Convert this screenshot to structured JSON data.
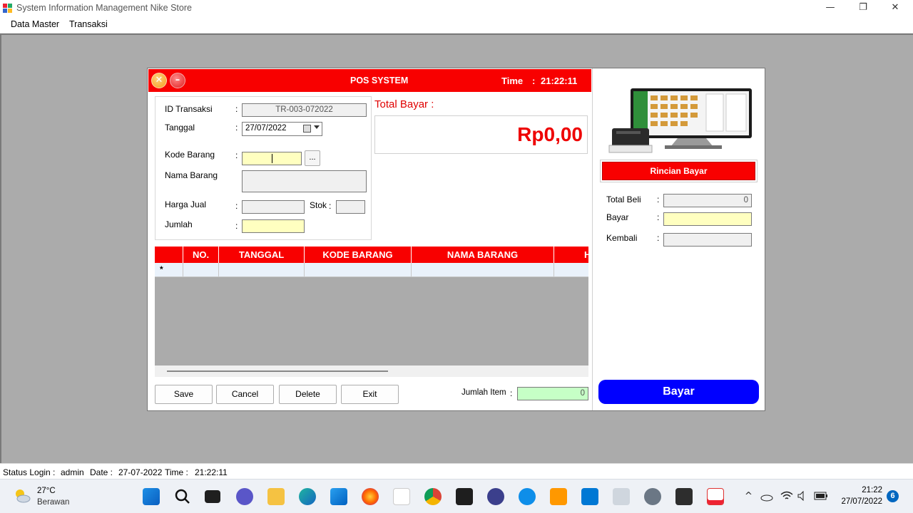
{
  "window": {
    "title": "System Information Management Nike Store",
    "min_glyph": "—",
    "restore_glyph": "❐",
    "close_glyph": "✕"
  },
  "menu": [
    "Data Master",
    "Transaksi"
  ],
  "pos": {
    "header_title": "POS SYSTEM",
    "time_label": "Time",
    "time_sep": ":",
    "time_value": "21:22:11",
    "close_glyph": "✕",
    "min_glyph": "–",
    "colon": ":",
    "labels": {
      "id_transaksi": "ID Transaksi",
      "tanggal": "Tanggal",
      "kode_barang": "Kode Barang",
      "nama_barang": "Nama Barang",
      "harga_jual": "Harga Jual",
      "stok": "Stok",
      "jumlah": "Jumlah"
    },
    "values": {
      "id_transaksi": "TR-003-072022",
      "tanggal": "27/07/2022",
      "kode_barang": "",
      "nama_barang": "",
      "harga_jual": "",
      "stok": "",
      "jumlah": ""
    },
    "browse_label": "...",
    "total_label": "Total Bayar  :",
    "total_value": "Rp0,00",
    "grid": {
      "columns": [
        "",
        "NO.",
        "TANGGAL",
        "KODE BARANG",
        "NAMA BARANG",
        "HARGA JUAL"
      ],
      "new_row_marker": "*"
    },
    "buttons": {
      "save": "Save",
      "cancel": "Cancel",
      "delete": "Delete",
      "exit": "Exit"
    },
    "jumlah_item_label": "Jumlah Item",
    "jumlah_item_value": "0",
    "rincian": {
      "title": "Rincian Bayar",
      "total_beli_label": "Total Beli",
      "total_beli_value": "0",
      "bayar_label": "Bayar",
      "bayar_value": "",
      "kembali_label": "Kembali",
      "kembali_value": ""
    },
    "bayar_button": "Bayar"
  },
  "status": {
    "login_label": "Status Login :",
    "user": "admin",
    "date_label": "Date :",
    "date": "27-07-2022",
    "time_label": "Time :",
    "time": "21:22:11"
  },
  "taskbar": {
    "weather_temp": "27°C",
    "weather_desc": "Berawan",
    "clock_time": "21:22",
    "clock_date": "27/07/2022",
    "notification_count": "6",
    "tray_chevron": "^"
  },
  "colors": {
    "accent_red": "#f80000",
    "pay_blue": "#0000ff",
    "input_yellow": "#ffffc0",
    "jumlah_green": "#c6ffc6"
  }
}
